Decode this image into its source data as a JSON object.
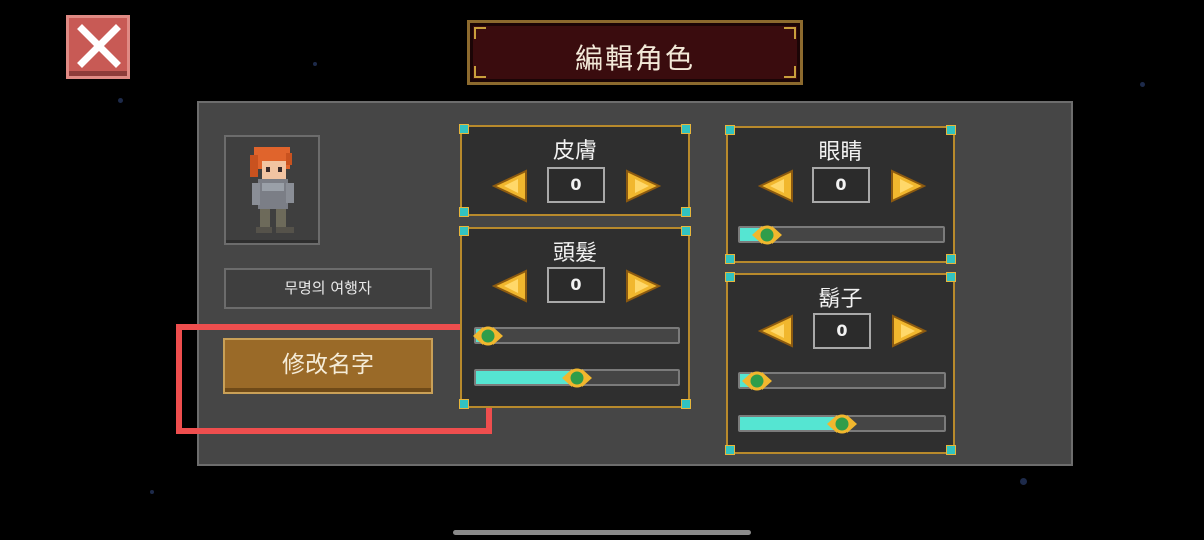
{
  "window": {
    "title": "編輯角色"
  },
  "close_button": {
    "icon": "close-icon"
  },
  "character": {
    "name": "무명의 여행자"
  },
  "rename_button": {
    "label": "修改名字"
  },
  "attributes": {
    "skin": {
      "label": "皮膚",
      "value": "0"
    },
    "hair": {
      "label": "頭髮",
      "value": "0",
      "slider1_level": 0.06,
      "slider2_level": 0.49
    },
    "eyes": {
      "label": "眼睛",
      "value": "0",
      "slider1_level": 0.13
    },
    "beard": {
      "label": "鬍子",
      "value": "0",
      "slider1_level": 0.08,
      "slider2_level": 0.49
    }
  },
  "colors": {
    "accent_gold": "#e6b63c",
    "slider_fill": "#55e5d2",
    "highlight": "#ee4e4e",
    "rename_button": "#9a6a28"
  }
}
